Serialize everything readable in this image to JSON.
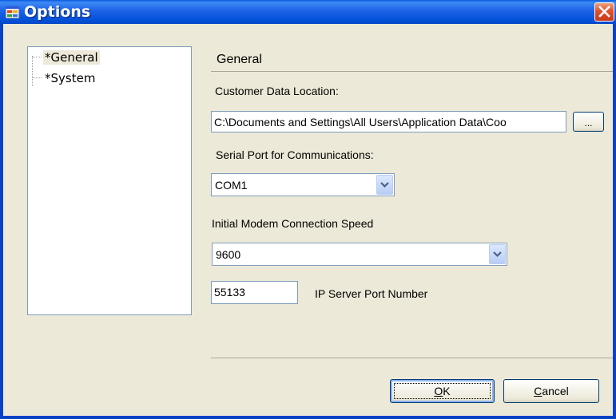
{
  "window": {
    "title": "Options"
  },
  "tree": {
    "items": [
      {
        "label": "*General"
      },
      {
        "label": "*System"
      }
    ]
  },
  "general": {
    "section_title": "General",
    "customer_data_label": "Customer Data Location:",
    "customer_data_value": "C:\\Documents and Settings\\All Users\\Application Data\\Coo",
    "browse_label": "...",
    "serial_port_label": "Serial Port for Communications:",
    "serial_port_value": "COM1",
    "modem_speed_label": "Initial Modem Connection Speed",
    "modem_speed_value": "9600",
    "ip_port_value": "55133",
    "ip_port_label": "IP Server Port Number"
  },
  "buttons": {
    "ok_mnemonic": "O",
    "ok_rest": "K",
    "cancel_mnemonic": "C",
    "cancel_rest": "ancel"
  },
  "colors": {
    "titlebar": "#0553db",
    "close": "#e0502a",
    "dialog_bg": "#ece9d8"
  },
  "icons": {
    "app": "options-window-icon",
    "close": "close-icon",
    "dropdown": "chevron-down-icon"
  }
}
